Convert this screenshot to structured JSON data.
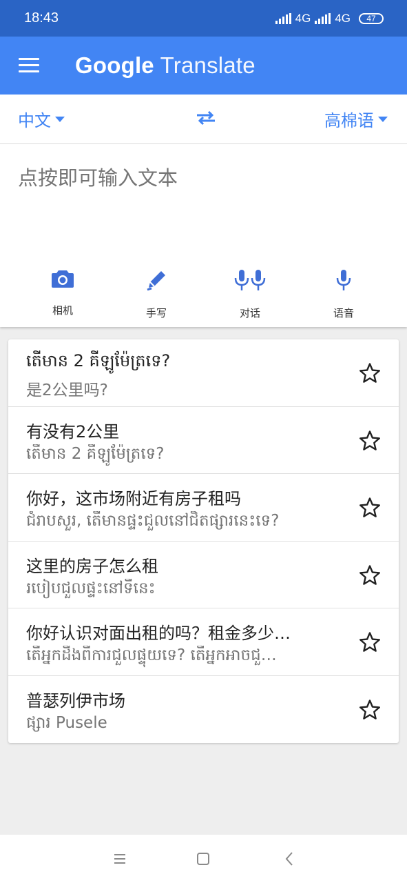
{
  "status": {
    "time": "18:43",
    "net1": "4G",
    "net2": "4G",
    "battery": "47"
  },
  "appbar": {
    "title_brand": "Google",
    "title_product": "Translate"
  },
  "languages": {
    "source": "中文",
    "target": "高棉语"
  },
  "input": {
    "placeholder": "点按即可输入文本"
  },
  "tools": [
    {
      "label": "相机",
      "icon": "camera-icon"
    },
    {
      "label": "手写",
      "icon": "pen-icon"
    },
    {
      "label": "对话",
      "icon": "dual-mic-icon"
    },
    {
      "label": "语音",
      "icon": "mic-icon"
    }
  ],
  "history": [
    {
      "source": "តើមាន 2 គីឡូម៉ែត្រទេ?",
      "translation": "是2公里吗?"
    },
    {
      "source": "有没有2公里",
      "translation": "តើមាន 2 គីឡូម៉ែត្រទេ?"
    },
    {
      "source": "你好，这市场附近有房子租吗",
      "translation": "ជំរាបសួរ, តើមានផ្ទះជួលនៅជិតផ្សារនេះទេ?"
    },
    {
      "source": "这里的房子怎么租",
      "translation": "របៀបជួលផ្ទះនៅទីនេះ"
    },
    {
      "source": "你好认识对面出租的吗？租金多少…",
      "translation": "តើអ្នកដឹងពីការជួលផ្ទុយទេ? តើអ្នកអាចជួ…"
    },
    {
      "source": "普瑟列伊市场",
      "translation": "ផ្សារ Pusele"
    }
  ],
  "colors": {
    "statusbar": "#2a64c5",
    "appbar": "#4285f4",
    "accent": "#4285f4"
  }
}
